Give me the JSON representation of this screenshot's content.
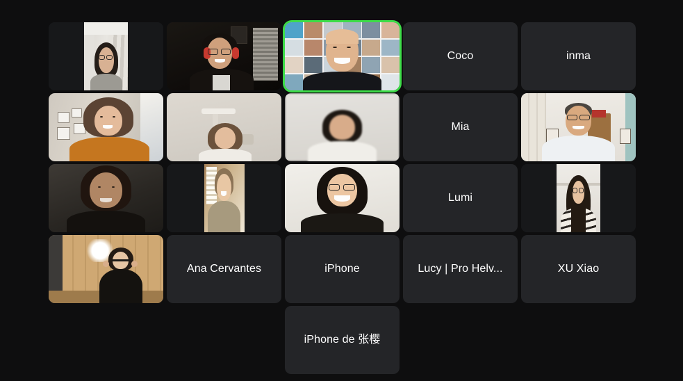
{
  "app": {
    "name": "video-conference",
    "layout": "tiled-gallery",
    "background_color": "#0e0e0f",
    "tile_color": "#242528",
    "active_speaker_border_color": "#3ddc48",
    "label_color": "#ffffff"
  },
  "grid": {
    "columns": 5,
    "rows": 5,
    "total_participants": 21
  },
  "rows": [
    {
      "tiles": [
        {
          "id": "p1",
          "kind": "video",
          "label": "",
          "speaking": false
        },
        {
          "id": "p2",
          "kind": "video",
          "label": "",
          "speaking": false
        },
        {
          "id": "p3",
          "kind": "video",
          "label": "",
          "speaking": true
        },
        {
          "id": "p4",
          "kind": "name",
          "label": "Coco",
          "speaking": false
        },
        {
          "id": "p5",
          "kind": "name",
          "label": "inma",
          "speaking": false
        }
      ]
    },
    {
      "tiles": [
        {
          "id": "p6",
          "kind": "video",
          "label": "",
          "speaking": false
        },
        {
          "id": "p7",
          "kind": "video",
          "label": "",
          "speaking": false
        },
        {
          "id": "p8",
          "kind": "video",
          "label": "",
          "speaking": false
        },
        {
          "id": "p9",
          "kind": "name",
          "label": "Mia",
          "speaking": false
        },
        {
          "id": "p10",
          "kind": "video",
          "label": "",
          "speaking": false
        }
      ]
    },
    {
      "tiles": [
        {
          "id": "p11",
          "kind": "video",
          "label": "",
          "speaking": false
        },
        {
          "id": "p12",
          "kind": "video",
          "label": "",
          "speaking": false
        },
        {
          "id": "p13",
          "kind": "video",
          "label": "",
          "speaking": false
        },
        {
          "id": "p14",
          "kind": "name",
          "label": "Lumi",
          "speaking": false
        },
        {
          "id": "p15",
          "kind": "video",
          "label": "",
          "speaking": false
        }
      ]
    },
    {
      "tiles": [
        {
          "id": "p16",
          "kind": "video",
          "label": "",
          "speaking": false
        },
        {
          "id": "p17",
          "kind": "name",
          "label": "Ana Cervantes",
          "speaking": false
        },
        {
          "id": "p18",
          "kind": "name",
          "label": "iPhone",
          "speaking": false
        },
        {
          "id": "p19",
          "kind": "name",
          "label": "Lucy | Pro Helv...",
          "speaking": false
        },
        {
          "id": "p20",
          "kind": "name",
          "label": "XU Xiao",
          "speaking": false
        }
      ]
    },
    {
      "tiles": [
        {
          "id": "p21",
          "kind": "name",
          "label": "iPhone de 张樱",
          "speaking": false
        }
      ]
    }
  ]
}
